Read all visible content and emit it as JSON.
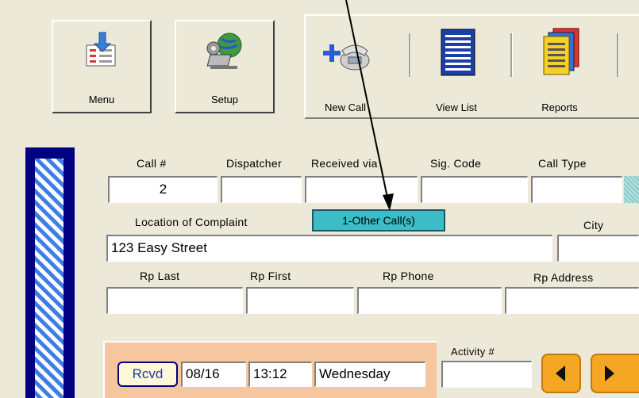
{
  "toolbar": {
    "menu_label": "Menu",
    "setup_label": "Setup",
    "new_call_label": "New Call",
    "view_list_label": "View List",
    "reports_label": "Reports"
  },
  "form": {
    "call_num_label": "Call #",
    "call_num_value": "2",
    "dispatcher_label": "Dispatcher",
    "dispatcher_value": "",
    "received_via_label": "Received via",
    "received_via_value": "",
    "sig_code_label": "Sig. Code",
    "sig_code_value": "",
    "call_type_label": "Call Type",
    "call_type_value": "",
    "location_label": "Location of Complaint",
    "location_value": "123 Easy Street",
    "other_calls_badge": "1-Other Call(s)",
    "city_label": "City",
    "city_value": "",
    "rp_last_label": "Rp Last",
    "rp_first_label": "Rp First",
    "rp_phone_label": "Rp Phone",
    "rp_address_label": "Rp Address"
  },
  "received": {
    "rcvd_button": "Rcvd",
    "date": "08/16",
    "time": "13:12",
    "day": "Wednesday",
    "activity_label": "Activity #",
    "activity_value": ""
  },
  "colors": {
    "badge": "#3bbcc6",
    "panel_orange": "#f6c79e",
    "nav_button": "#f5a623"
  }
}
